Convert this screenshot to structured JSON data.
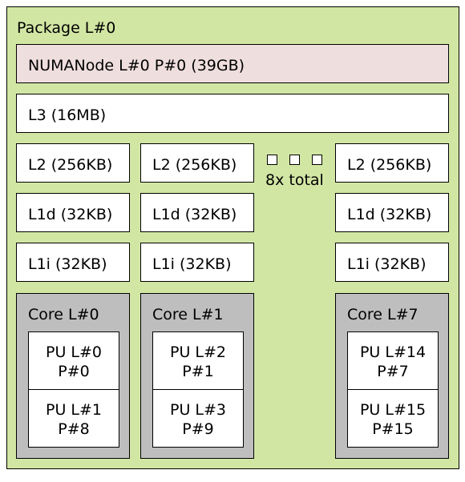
{
  "package": {
    "label": "Package L#0"
  },
  "numa": {
    "label": "NUMANode L#0 P#0 (39GB)"
  },
  "l3": {
    "label": "L3 (16MB)"
  },
  "columns": [
    {
      "l2": "L2 (256KB)",
      "l1d": "L1d (32KB)",
      "l1i": "L1i (32KB)",
      "core": "Core L#0",
      "pus": [
        {
          "line1": "PU L#0",
          "line2": "P#0"
        },
        {
          "line1": "PU L#1",
          "line2": "P#8"
        }
      ]
    },
    {
      "l2": "L2 (256KB)",
      "l1d": "L1d (32KB)",
      "l1i": "L1i (32KB)",
      "core": "Core L#1",
      "pus": [
        {
          "line1": "PU L#2",
          "line2": "P#1"
        },
        {
          "line1": "PU L#3",
          "line2": "P#9"
        }
      ]
    },
    {
      "l2": "L2 (256KB)",
      "l1d": "L1d (32KB)",
      "l1i": "L1i (32KB)",
      "core": "Core L#7",
      "pus": [
        {
          "line1": "PU L#14",
          "line2": "P#7"
        },
        {
          "line1": "PU L#15",
          "line2": "P#15"
        }
      ]
    }
  ],
  "collapsed": {
    "label": "8x total"
  },
  "colors": {
    "package": "#d2e6a4",
    "numa": "#efdede",
    "cache": "#ffffff",
    "core": "#bebebe",
    "pu": "#ffffff"
  }
}
